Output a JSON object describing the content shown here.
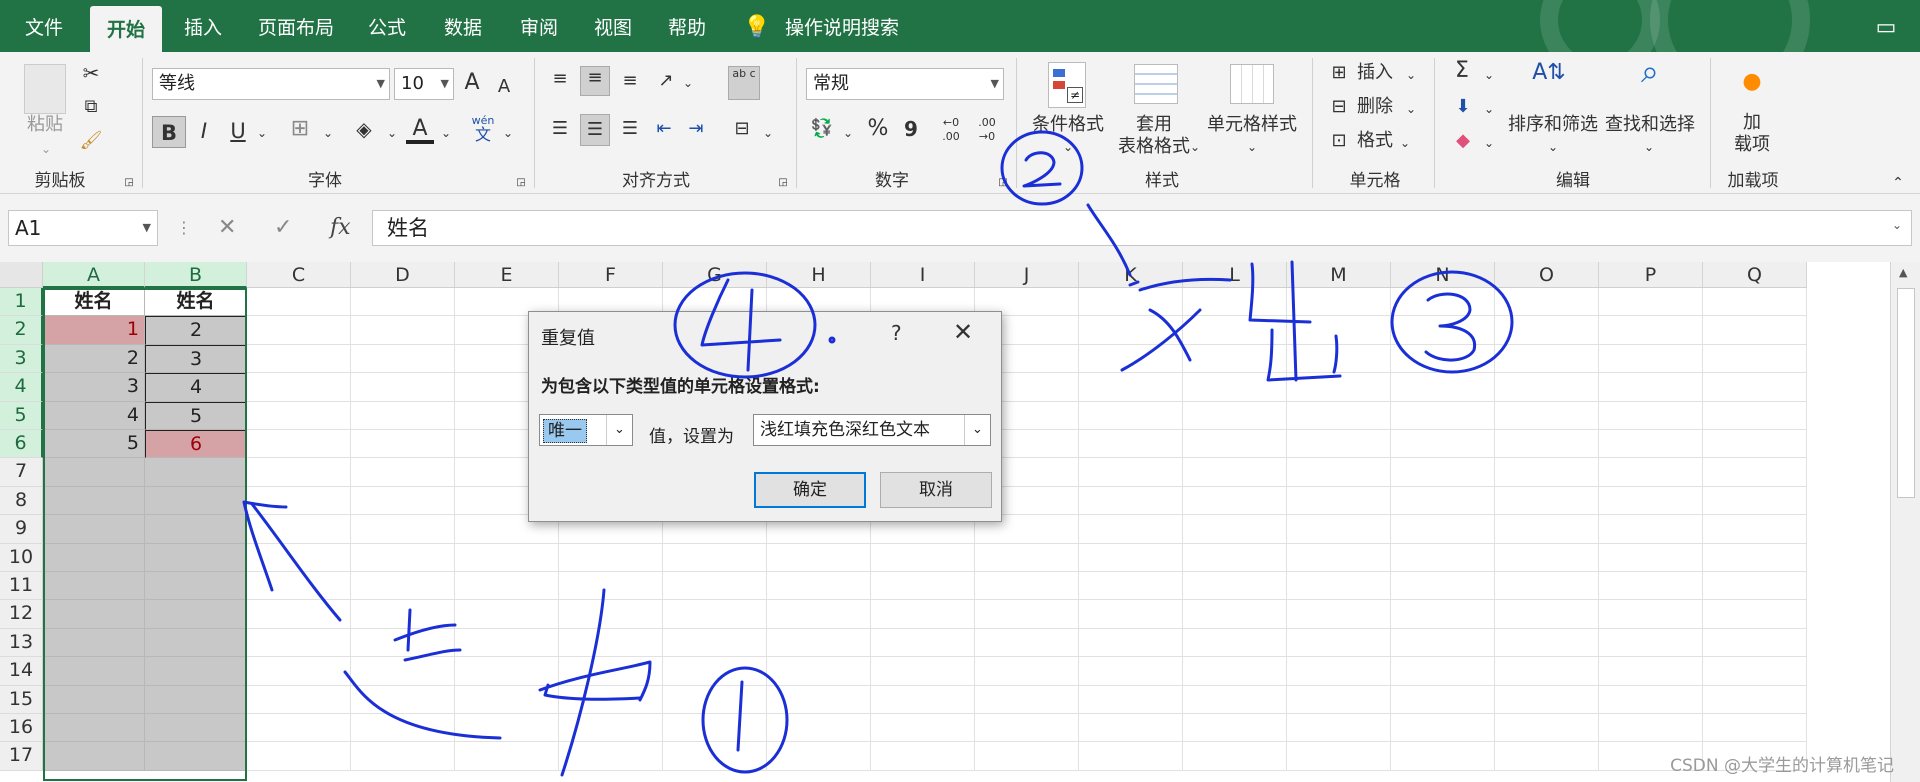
{
  "menu": {
    "tabs": [
      "文件",
      "开始",
      "插入",
      "页面布局",
      "公式",
      "数据",
      "审阅",
      "视图",
      "帮助"
    ],
    "search": "操作说明搜索"
  },
  "ribbon": {
    "clipboard": {
      "paste": "粘贴",
      "label": "剪贴板"
    },
    "font": {
      "name": "等线",
      "size": "10",
      "label": "字体",
      "bold": "B",
      "italic": "I",
      "underline": "U",
      "grow": "A",
      "shrink": "A",
      "color_a": "A",
      "wen": "wén",
      "wen_char": "文"
    },
    "align": {
      "label": "对齐方式",
      "wrap": "ab c"
    },
    "number": {
      "format": "常规",
      "label": "数字",
      "percent": "%",
      "comma": "9",
      "inc": "←0 .00",
      "dec": ".00 →0"
    },
    "styles": {
      "cond": "条件格式",
      "table": "套用表格格式",
      "table_line1": "套用",
      "table_line2": "表格格式",
      "cellstyle": "单元格样式",
      "label": "样式"
    },
    "cells": {
      "insert": "插入",
      "delete": "删除",
      "format": "格式",
      "label": "单元格"
    },
    "edit": {
      "sort": "排序和筛选",
      "find": "查找和选择",
      "label": "编辑",
      "sigma": "Σ"
    },
    "addins": {
      "add1": "加",
      "add2": "载项",
      "label": "加载项"
    }
  },
  "formula_bar": {
    "cell": "A1",
    "content": "姓名",
    "fx": "fx"
  },
  "grid": {
    "columns": [
      "A",
      "B",
      "C",
      "D",
      "E",
      "F",
      "G",
      "H",
      "I",
      "J",
      "K",
      "L",
      "M",
      "N",
      "O",
      "P",
      "Q"
    ],
    "rows": [
      "1",
      "2",
      "3",
      "4",
      "5",
      "6",
      "7",
      "8",
      "9",
      "10",
      "11",
      "12",
      "13",
      "14",
      "15",
      "16",
      "17"
    ],
    "colA": [
      "姓名",
      "1",
      "2",
      "3",
      "4",
      "5"
    ],
    "colB": [
      "姓名",
      "2",
      "3",
      "4",
      "5",
      "6"
    ]
  },
  "dialog": {
    "title": "重复值",
    "help": "?",
    "prompt": "为包含以下类型值的单元格设置格式:",
    "type_value": "唯一",
    "middle": "值，设置为",
    "format_value": "浅红填充色深红色文本",
    "ok": "确定",
    "cancel": "取消"
  },
  "watermark": "CSDN @大学生的计算机笔记",
  "colors": {
    "accent": "#217346",
    "highlight_fill": "#d5a2a6",
    "highlight_text": "#9c0006",
    "ink": "#1a2fd6"
  }
}
